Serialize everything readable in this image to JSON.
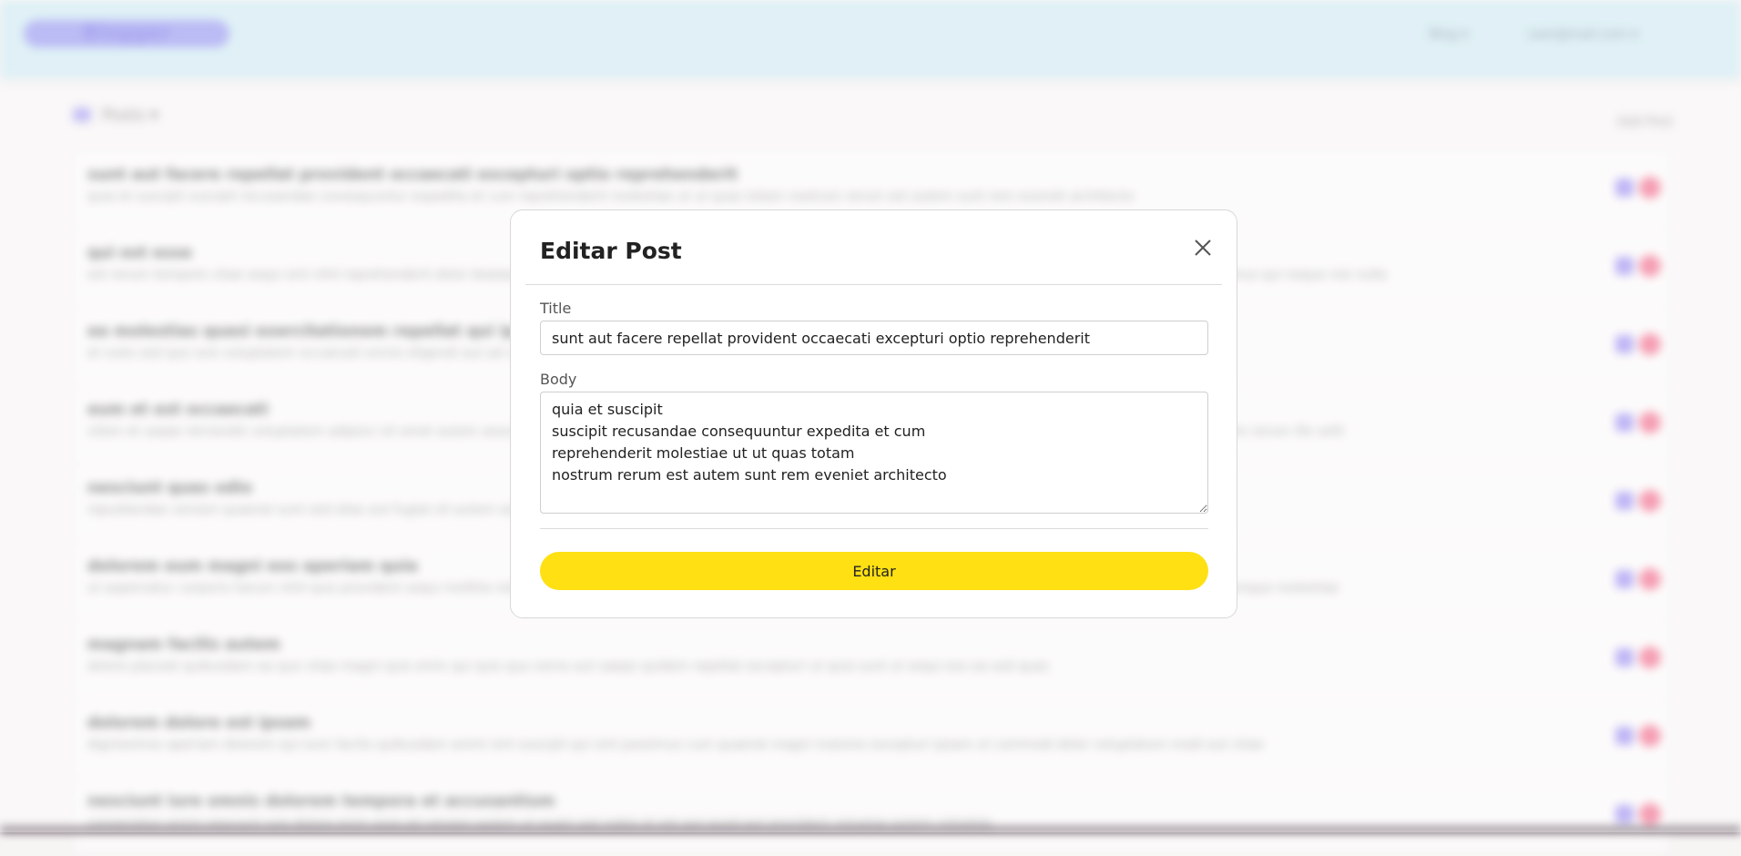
{
  "header": {
    "logo_text": "Blogger",
    "nav": [
      {
        "label": "Blog ▾"
      },
      {
        "label": "user@mail.com ▾"
      }
    ]
  },
  "page": {
    "heading": "Posts ▾",
    "action_label": "Add Post"
  },
  "posts": [
    {
      "title": "sunt aut facere repellat provident occaecati excepturi optio reprehenderit",
      "body": "quia et suscipit suscipit recusandae consequuntur expedita et cum reprehenderit molestiae ut ut quas totam nostrum rerum est autem sunt rem eveniet architecto"
    },
    {
      "title": "qui est esse",
      "body": "est rerum tempore vitae sequi sint nihil reprehenderit dolor beatae ea dolores neque fugiat blanditiis voluptate porro vel nihil molestiae ut reiciendis qui aperiam non debitis possimus qui neque nisi nulla"
    },
    {
      "title": "ea molestias quasi exercitationem repellat qui ipsa sit aut",
      "body": "et iusto sed quo iure voluptatem occaecati omnis eligendi aut ad voluptatem doloribus vel accusantium quis pariatur"
    },
    {
      "title": "eum et est occaecati",
      "body": "ullam et saepe reiciendis voluptatem adipisci sit amet autem assumenda provident rerum culpa quis hic commodi nesciunt rem tenetur doloremque ipsam iure quis sunt voluptatem rerum illo velit"
    },
    {
      "title": "nesciunt quas odio",
      "body": "repudiandae veniam quaerat sunt sed alias aut fugiat sit autem sed est voluptatem omnis possimus esse voluptatibus quis"
    },
    {
      "title": "dolorem eum magni eos aperiam quia",
      "body": "ut aspernatur corporis harum nihil quis provident sequi mollitia nobis aliquid molestiae perspiciatis et ea nemo ab reprehenderit accusantium quas voluptate dolores velit et doloremque molestiae"
    },
    {
      "title": "magnam facilis autem",
      "body": "dolore placeat quibusdam ea quo vitae magni quis enim qui quis quo nemo aut saepe quidem repellat excepturi ut quia sunt ut sequi eos ea sed quas"
    },
    {
      "title": "dolorem dolore est ipsam",
      "body": "dignissimos aperiam dolorem qui eum facilis quibusdam animi sint suscipit qui sint possimus cum quaerat magni maiores excepturi ipsam ut commodi dolor voluptatum modi aut vitae"
    },
    {
      "title": "nesciunt iure omnis dolorem tempora et accusantium",
      "body": "consectetur animi nesciunt iure dolore enim quia ad veniam autem ut quam aut nobis et est aut quod aut provident voluptas autem voluptas"
    }
  ],
  "modal": {
    "title": "Editar Post",
    "title_label": "Title",
    "title_value": "sunt aut facere repellat provident occaecati excepturi optio reprehenderit",
    "body_label": "Body",
    "body_value": "quia et suscipit\nsuscipit recusandae consequuntur expedita et cum\nreprehenderit molestiae ut ut quas totam\nnostrum rerum est autem sunt rem eveniet architecto",
    "submit_label": "Editar",
    "close_icon": "close-icon"
  },
  "colors": {
    "header_bg": "#cfe9f1",
    "submit_bg": "#ffe013",
    "edit_icon": "#9b8ef0",
    "delete_icon": "#f06a8a"
  }
}
